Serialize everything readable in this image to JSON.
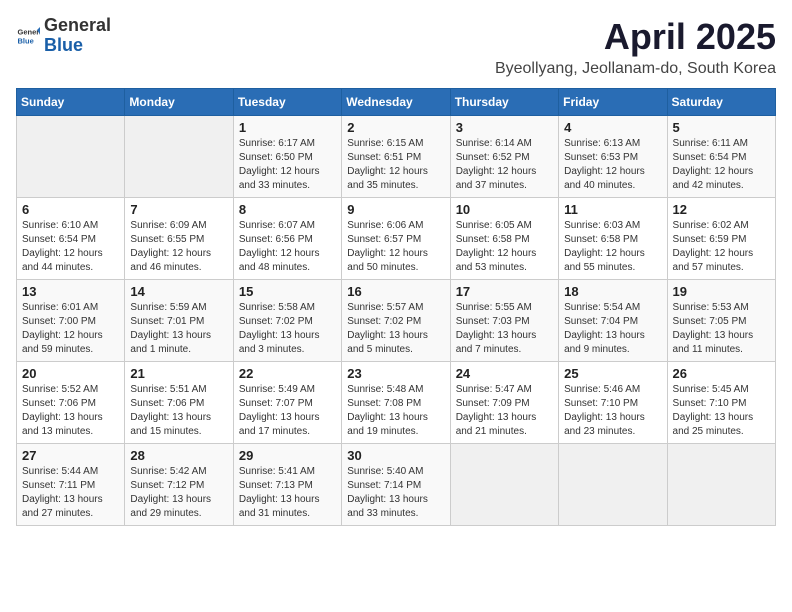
{
  "header": {
    "logo_general": "General",
    "logo_blue": "Blue",
    "title": "April 2025",
    "subtitle": "Byeollyang, Jeollanam-do, South Korea"
  },
  "calendar": {
    "weekdays": [
      "Sunday",
      "Monday",
      "Tuesday",
      "Wednesday",
      "Thursday",
      "Friday",
      "Saturday"
    ],
    "weeks": [
      [
        {
          "day": "",
          "info": ""
        },
        {
          "day": "",
          "info": ""
        },
        {
          "day": "1",
          "info": "Sunrise: 6:17 AM\nSunset: 6:50 PM\nDaylight: 12 hours\nand 33 minutes."
        },
        {
          "day": "2",
          "info": "Sunrise: 6:15 AM\nSunset: 6:51 PM\nDaylight: 12 hours\nand 35 minutes."
        },
        {
          "day": "3",
          "info": "Sunrise: 6:14 AM\nSunset: 6:52 PM\nDaylight: 12 hours\nand 37 minutes."
        },
        {
          "day": "4",
          "info": "Sunrise: 6:13 AM\nSunset: 6:53 PM\nDaylight: 12 hours\nand 40 minutes."
        },
        {
          "day": "5",
          "info": "Sunrise: 6:11 AM\nSunset: 6:54 PM\nDaylight: 12 hours\nand 42 minutes."
        }
      ],
      [
        {
          "day": "6",
          "info": "Sunrise: 6:10 AM\nSunset: 6:54 PM\nDaylight: 12 hours\nand 44 minutes."
        },
        {
          "day": "7",
          "info": "Sunrise: 6:09 AM\nSunset: 6:55 PM\nDaylight: 12 hours\nand 46 minutes."
        },
        {
          "day": "8",
          "info": "Sunrise: 6:07 AM\nSunset: 6:56 PM\nDaylight: 12 hours\nand 48 minutes."
        },
        {
          "day": "9",
          "info": "Sunrise: 6:06 AM\nSunset: 6:57 PM\nDaylight: 12 hours\nand 50 minutes."
        },
        {
          "day": "10",
          "info": "Sunrise: 6:05 AM\nSunset: 6:58 PM\nDaylight: 12 hours\nand 53 minutes."
        },
        {
          "day": "11",
          "info": "Sunrise: 6:03 AM\nSunset: 6:58 PM\nDaylight: 12 hours\nand 55 minutes."
        },
        {
          "day": "12",
          "info": "Sunrise: 6:02 AM\nSunset: 6:59 PM\nDaylight: 12 hours\nand 57 minutes."
        }
      ],
      [
        {
          "day": "13",
          "info": "Sunrise: 6:01 AM\nSunset: 7:00 PM\nDaylight: 12 hours\nand 59 minutes."
        },
        {
          "day": "14",
          "info": "Sunrise: 5:59 AM\nSunset: 7:01 PM\nDaylight: 13 hours\nand 1 minute."
        },
        {
          "day": "15",
          "info": "Sunrise: 5:58 AM\nSunset: 7:02 PM\nDaylight: 13 hours\nand 3 minutes."
        },
        {
          "day": "16",
          "info": "Sunrise: 5:57 AM\nSunset: 7:02 PM\nDaylight: 13 hours\nand 5 minutes."
        },
        {
          "day": "17",
          "info": "Sunrise: 5:55 AM\nSunset: 7:03 PM\nDaylight: 13 hours\nand 7 minutes."
        },
        {
          "day": "18",
          "info": "Sunrise: 5:54 AM\nSunset: 7:04 PM\nDaylight: 13 hours\nand 9 minutes."
        },
        {
          "day": "19",
          "info": "Sunrise: 5:53 AM\nSunset: 7:05 PM\nDaylight: 13 hours\nand 11 minutes."
        }
      ],
      [
        {
          "day": "20",
          "info": "Sunrise: 5:52 AM\nSunset: 7:06 PM\nDaylight: 13 hours\nand 13 minutes."
        },
        {
          "day": "21",
          "info": "Sunrise: 5:51 AM\nSunset: 7:06 PM\nDaylight: 13 hours\nand 15 minutes."
        },
        {
          "day": "22",
          "info": "Sunrise: 5:49 AM\nSunset: 7:07 PM\nDaylight: 13 hours\nand 17 minutes."
        },
        {
          "day": "23",
          "info": "Sunrise: 5:48 AM\nSunset: 7:08 PM\nDaylight: 13 hours\nand 19 minutes."
        },
        {
          "day": "24",
          "info": "Sunrise: 5:47 AM\nSunset: 7:09 PM\nDaylight: 13 hours\nand 21 minutes."
        },
        {
          "day": "25",
          "info": "Sunrise: 5:46 AM\nSunset: 7:10 PM\nDaylight: 13 hours\nand 23 minutes."
        },
        {
          "day": "26",
          "info": "Sunrise: 5:45 AM\nSunset: 7:10 PM\nDaylight: 13 hours\nand 25 minutes."
        }
      ],
      [
        {
          "day": "27",
          "info": "Sunrise: 5:44 AM\nSunset: 7:11 PM\nDaylight: 13 hours\nand 27 minutes."
        },
        {
          "day": "28",
          "info": "Sunrise: 5:42 AM\nSunset: 7:12 PM\nDaylight: 13 hours\nand 29 minutes."
        },
        {
          "day": "29",
          "info": "Sunrise: 5:41 AM\nSunset: 7:13 PM\nDaylight: 13 hours\nand 31 minutes."
        },
        {
          "day": "30",
          "info": "Sunrise: 5:40 AM\nSunset: 7:14 PM\nDaylight: 13 hours\nand 33 minutes."
        },
        {
          "day": "",
          "info": ""
        },
        {
          "day": "",
          "info": ""
        },
        {
          "day": "",
          "info": ""
        }
      ]
    ]
  }
}
